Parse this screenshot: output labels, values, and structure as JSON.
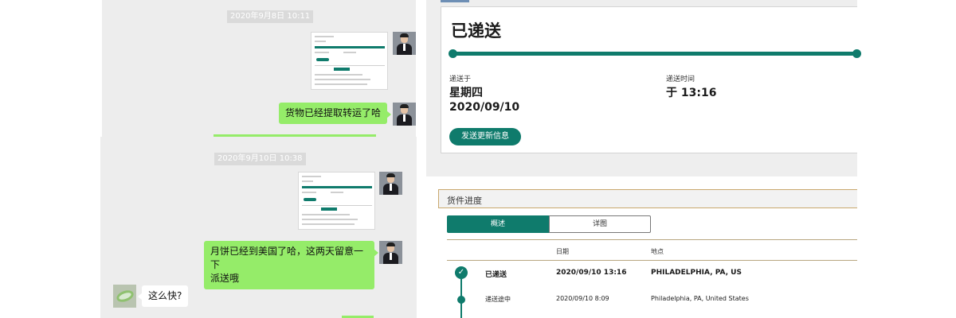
{
  "chat_top": {
    "timestamp": "2020年9月8日 10:11",
    "message": "货物已经提取转运了哈"
  },
  "chat_bottom": {
    "timestamp": "2020年9月10日 10:38",
    "message_line1": "月饼已经到美国了哈，这两天留意一下",
    "message_line2": "派送哦",
    "reply": "这么快?"
  },
  "tracking": {
    "status": "已递送",
    "delivered_on_label": "递送于",
    "weekday": "星期四",
    "date": "2020/09/10",
    "delivery_time_label": "递送时间",
    "time": "于 13:16",
    "send_update_button": "发送更新信息",
    "accent_color": "#0f7b6c"
  },
  "shipment": {
    "title": "货件进度",
    "tabs": [
      "概述",
      "详图"
    ],
    "columns": [
      "日期",
      "地点"
    ],
    "rows": [
      {
        "status": "已递送",
        "date": "2020/09/10  13:16",
        "location": "PHILADELPHIA, PA, US"
      },
      {
        "status": "递送途中",
        "date": "2020/09/10  8:09",
        "location": "Philadelphia, PA, United States"
      }
    ]
  }
}
